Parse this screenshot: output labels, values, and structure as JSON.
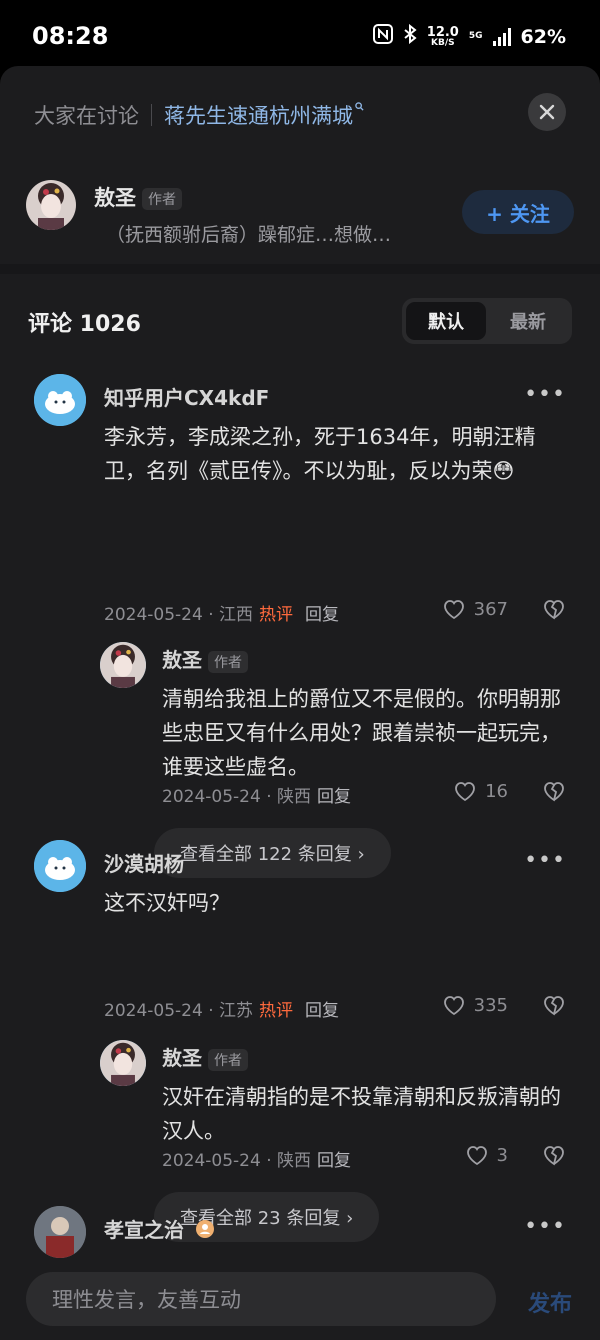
{
  "status": {
    "time": "08:28",
    "speed_value": "12.0",
    "speed_unit": "KB/S",
    "network": "5G",
    "battery": "62%"
  },
  "topic": {
    "label": "大家在讨论",
    "link": "蒋先生速通杭州满城"
  },
  "author": {
    "name": "敖圣",
    "tag": "作者",
    "desc": "（抚西额驸后裔）躁郁症…想做…",
    "follow": "+ 关注"
  },
  "comments_header": {
    "title": "评论 1026",
    "sort_default": "默认",
    "sort_new": "最新"
  },
  "comments": [
    {
      "user": "知乎用户CX4kdF",
      "text": "李永芳，李成梁之孙，死于1634年，明朝汪精卫，名列《贰臣传》。不以为耻，反以为荣😳",
      "date": "2024-05-24 · 江西",
      "hot": "热评",
      "reply_label": "回复",
      "likes": "367",
      "reply": {
        "user": "敖圣",
        "tag": "作者",
        "text": "清朝给我祖上的爵位又不是假的。你明朝那些忠臣又有什么用处？跟着崇祯一起玩完，谁要这些虚名。",
        "date": "2024-05-24 · 陕西",
        "reply_label": "回复",
        "likes": "16"
      },
      "more_replies": "查看全部 122 条回复 ›"
    },
    {
      "user": "沙漠胡杨",
      "text": "这不汉奸吗？",
      "date": "2024-05-24 · 江苏",
      "hot": "热评",
      "reply_label": "回复",
      "likes": "335",
      "reply": {
        "user": "敖圣",
        "tag": "作者",
        "text": "汉奸在清朝指的是不投靠清朝和反叛清朝的汉人。",
        "date": "2024-05-24 · 陕西",
        "reply_label": "回复",
        "likes": "3"
      },
      "more_replies": "查看全部 23 条回复 ›"
    },
    {
      "user": "孝宣之治"
    }
  ],
  "input": {
    "placeholder": "理性发言，友善互动",
    "publish": "发布"
  }
}
